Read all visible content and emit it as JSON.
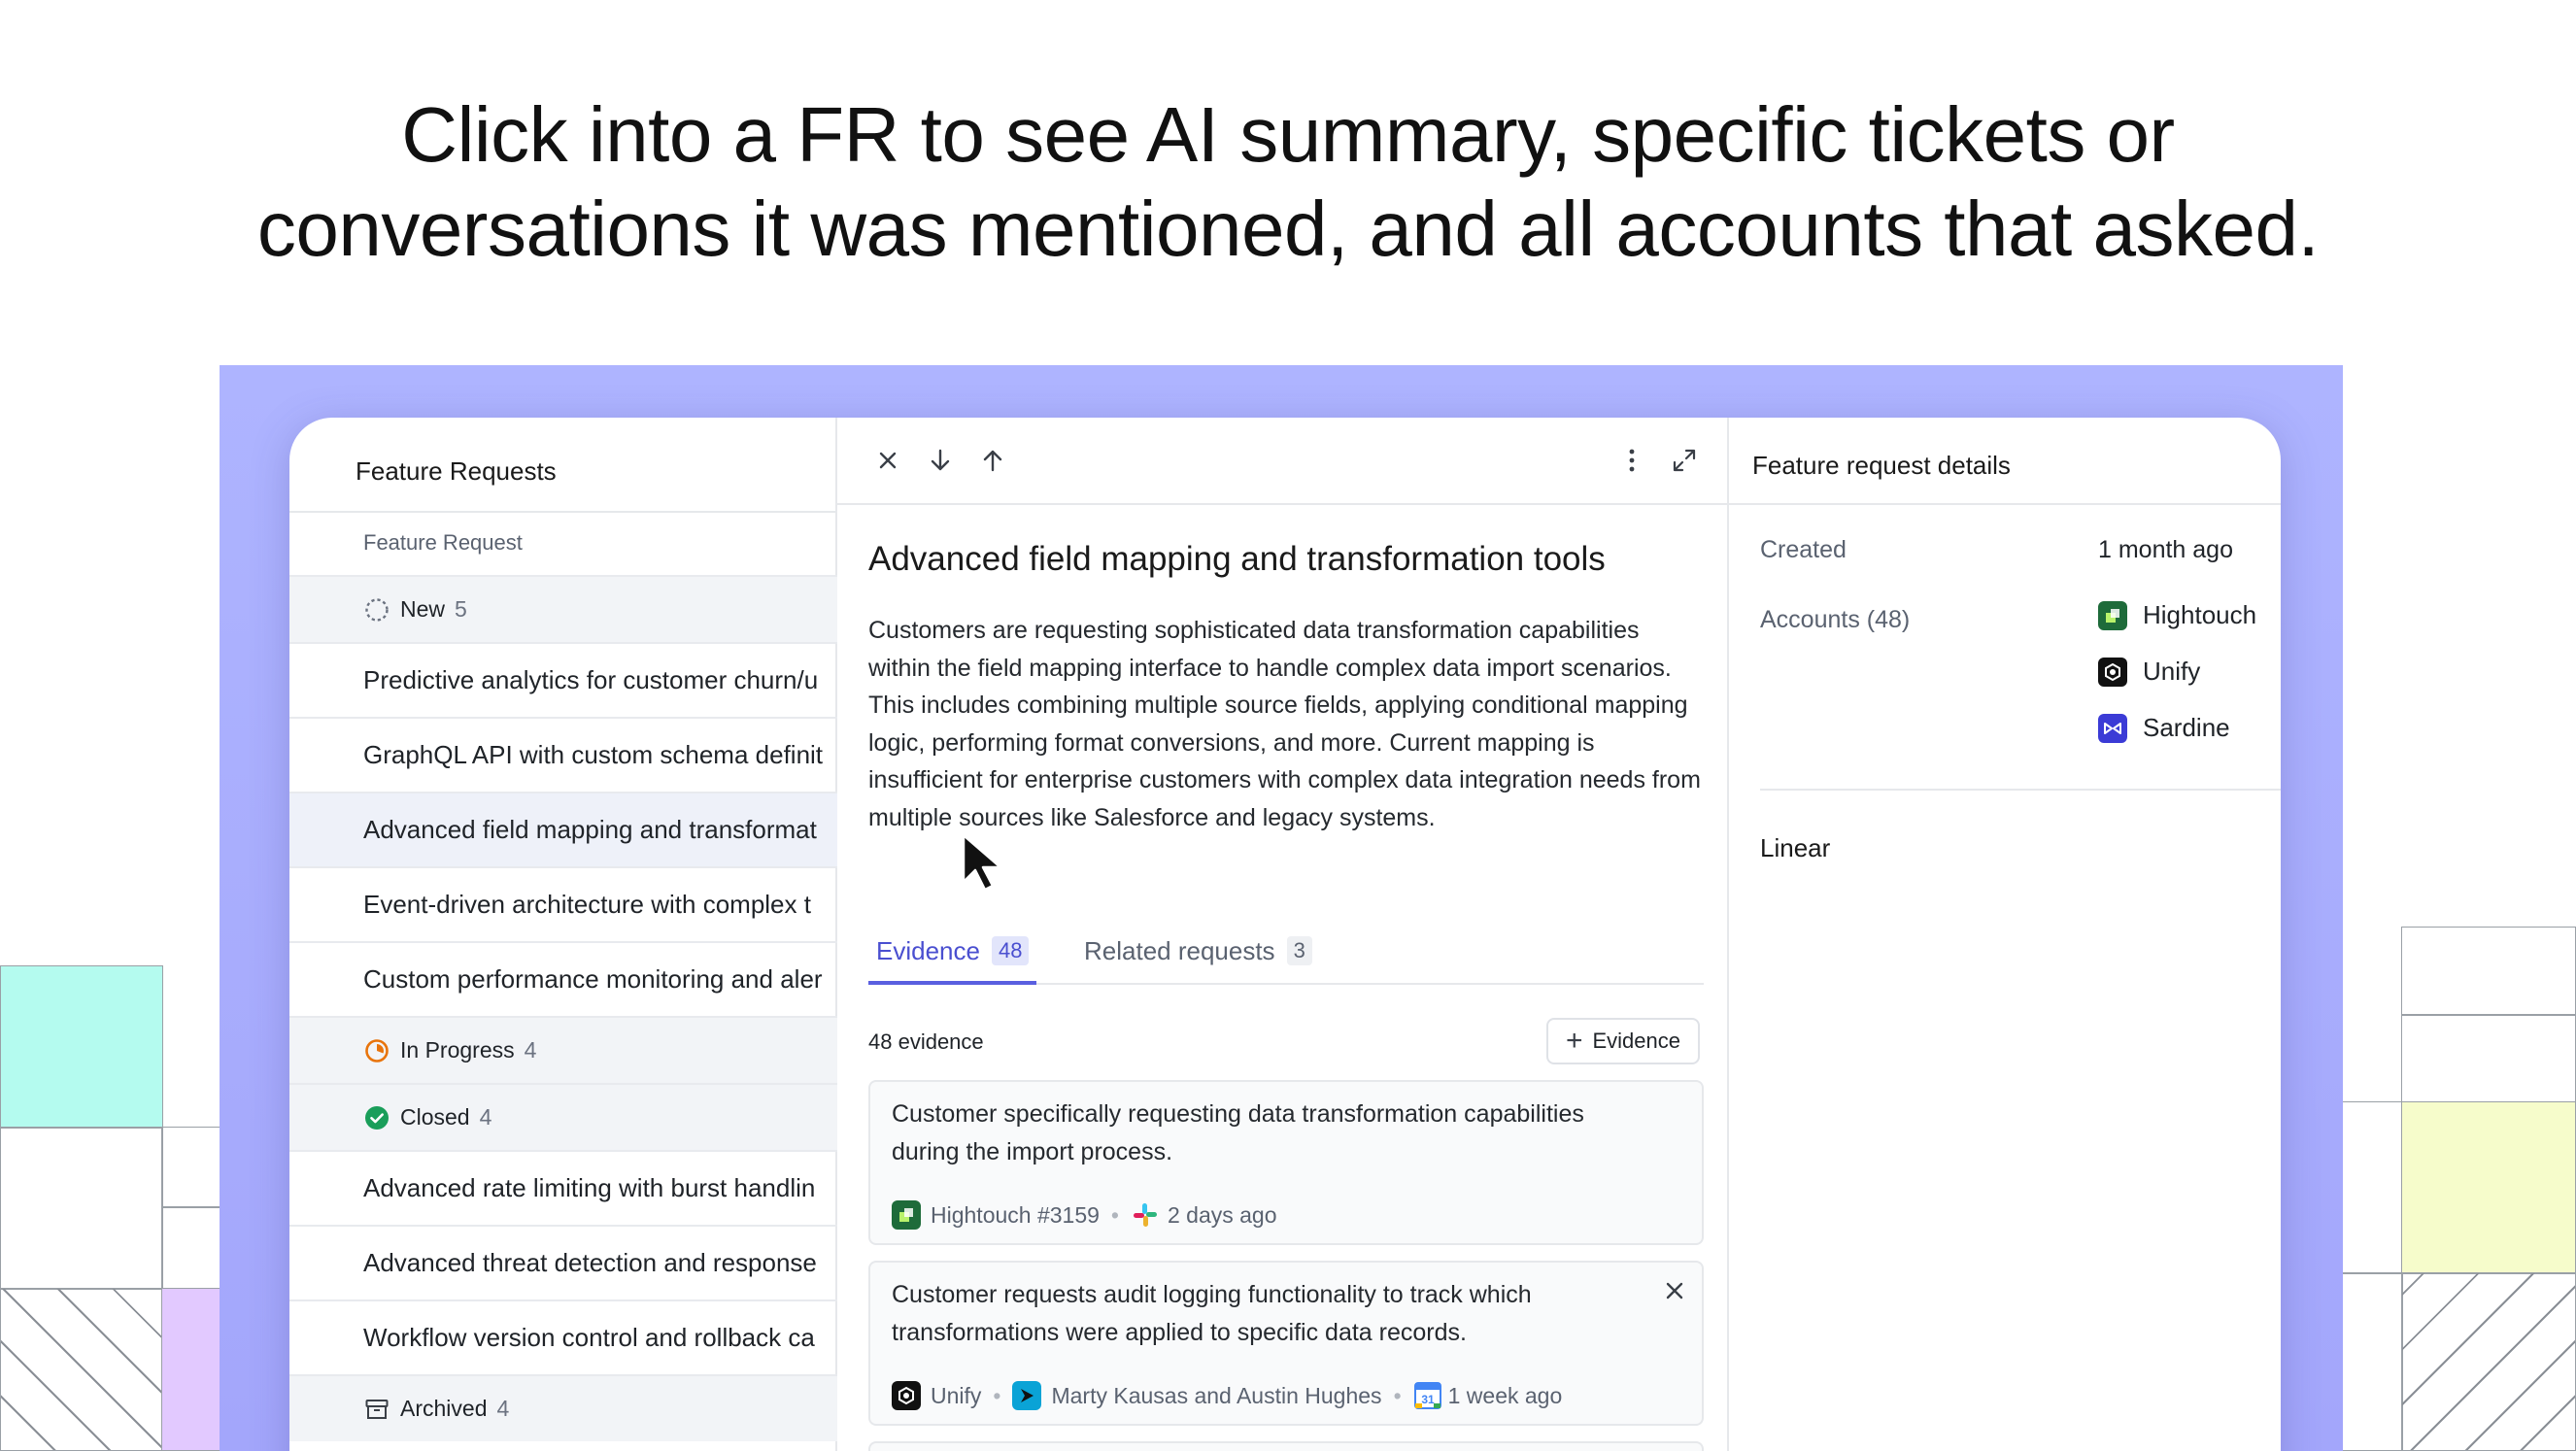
{
  "headline": {
    "line1": "Click into a FR to see AI summary, specific tickets or",
    "line2": "conversations it was mentioned, and all accounts that asked."
  },
  "left_panel": {
    "title": "Feature Requests",
    "column_header": "Feature Request",
    "groups": {
      "new": {
        "label": "New",
        "count": "5",
        "icon": "circle-dashed-icon"
      },
      "in_progress": {
        "label": "In Progress",
        "count": "4",
        "icon": "progress-icon"
      },
      "closed": {
        "label": "Closed",
        "count": "4",
        "icon": "check-circle-icon"
      },
      "archived": {
        "label": "Archived",
        "count": "4",
        "icon": "archive-icon"
      }
    },
    "new_items": [
      "Predictive analytics for customer churn/u",
      "GraphQL API with custom schema definit",
      "Advanced field mapping and transformat",
      "Event-driven architecture with complex t",
      "Custom performance monitoring and aler"
    ],
    "closed_items": [
      "Advanced rate limiting with burst handlin",
      "Advanced threat detection and response",
      "Workflow version control and rollback ca"
    ]
  },
  "detail": {
    "toolbar": {
      "close": "close-icon",
      "next": "arrow-down-icon",
      "prev": "arrow-up-icon",
      "more": "more-vertical-icon",
      "expand": "expand-icon"
    },
    "title": "Advanced field mapping and transformation tools",
    "description": "Customers are requesting sophisticated data transformation capabilities within the field mapping interface to handle complex data import scenarios. This includes combining multiple source fields, applying conditional mapping logic, performing format conversions, and more.  Current mapping is insufficient for enterprise customers with complex data integration needs from multiple sources like Salesforce and legacy systems.",
    "tabs": {
      "evidence": {
        "label": "Evidence",
        "count": "48"
      },
      "related": {
        "label": "Related requests",
        "count": "3"
      }
    },
    "evidence_count": "48 evidence",
    "add_evidence": "Evidence",
    "cards": [
      {
        "text": "Customer specifically requesting data transformation capabilities during the import process.",
        "account": "Hightouch #3159",
        "source": "slack-icon",
        "time": "2 days ago"
      },
      {
        "text": "Customer requests audit logging functionality to track which transformations were applied to specific data records.",
        "account": "Unify",
        "people": "Marty Kausas and Austin Hughes",
        "source": "calendar-icon",
        "time": "1 week ago"
      }
    ]
  },
  "details_panel": {
    "title": "Feature request details",
    "created_label": "Created",
    "created_value": "1 month ago",
    "accounts_label": "Accounts (48)",
    "accounts": [
      "Hightouch",
      "Unify",
      "Sardine"
    ],
    "linear_label": "Linear"
  },
  "colors": {
    "stage": "#aeb4ff",
    "accent": "#4a4fd0",
    "hightouch": "#1e6b3a",
    "unify": "#111111",
    "sardine": "#3b3bd6"
  }
}
